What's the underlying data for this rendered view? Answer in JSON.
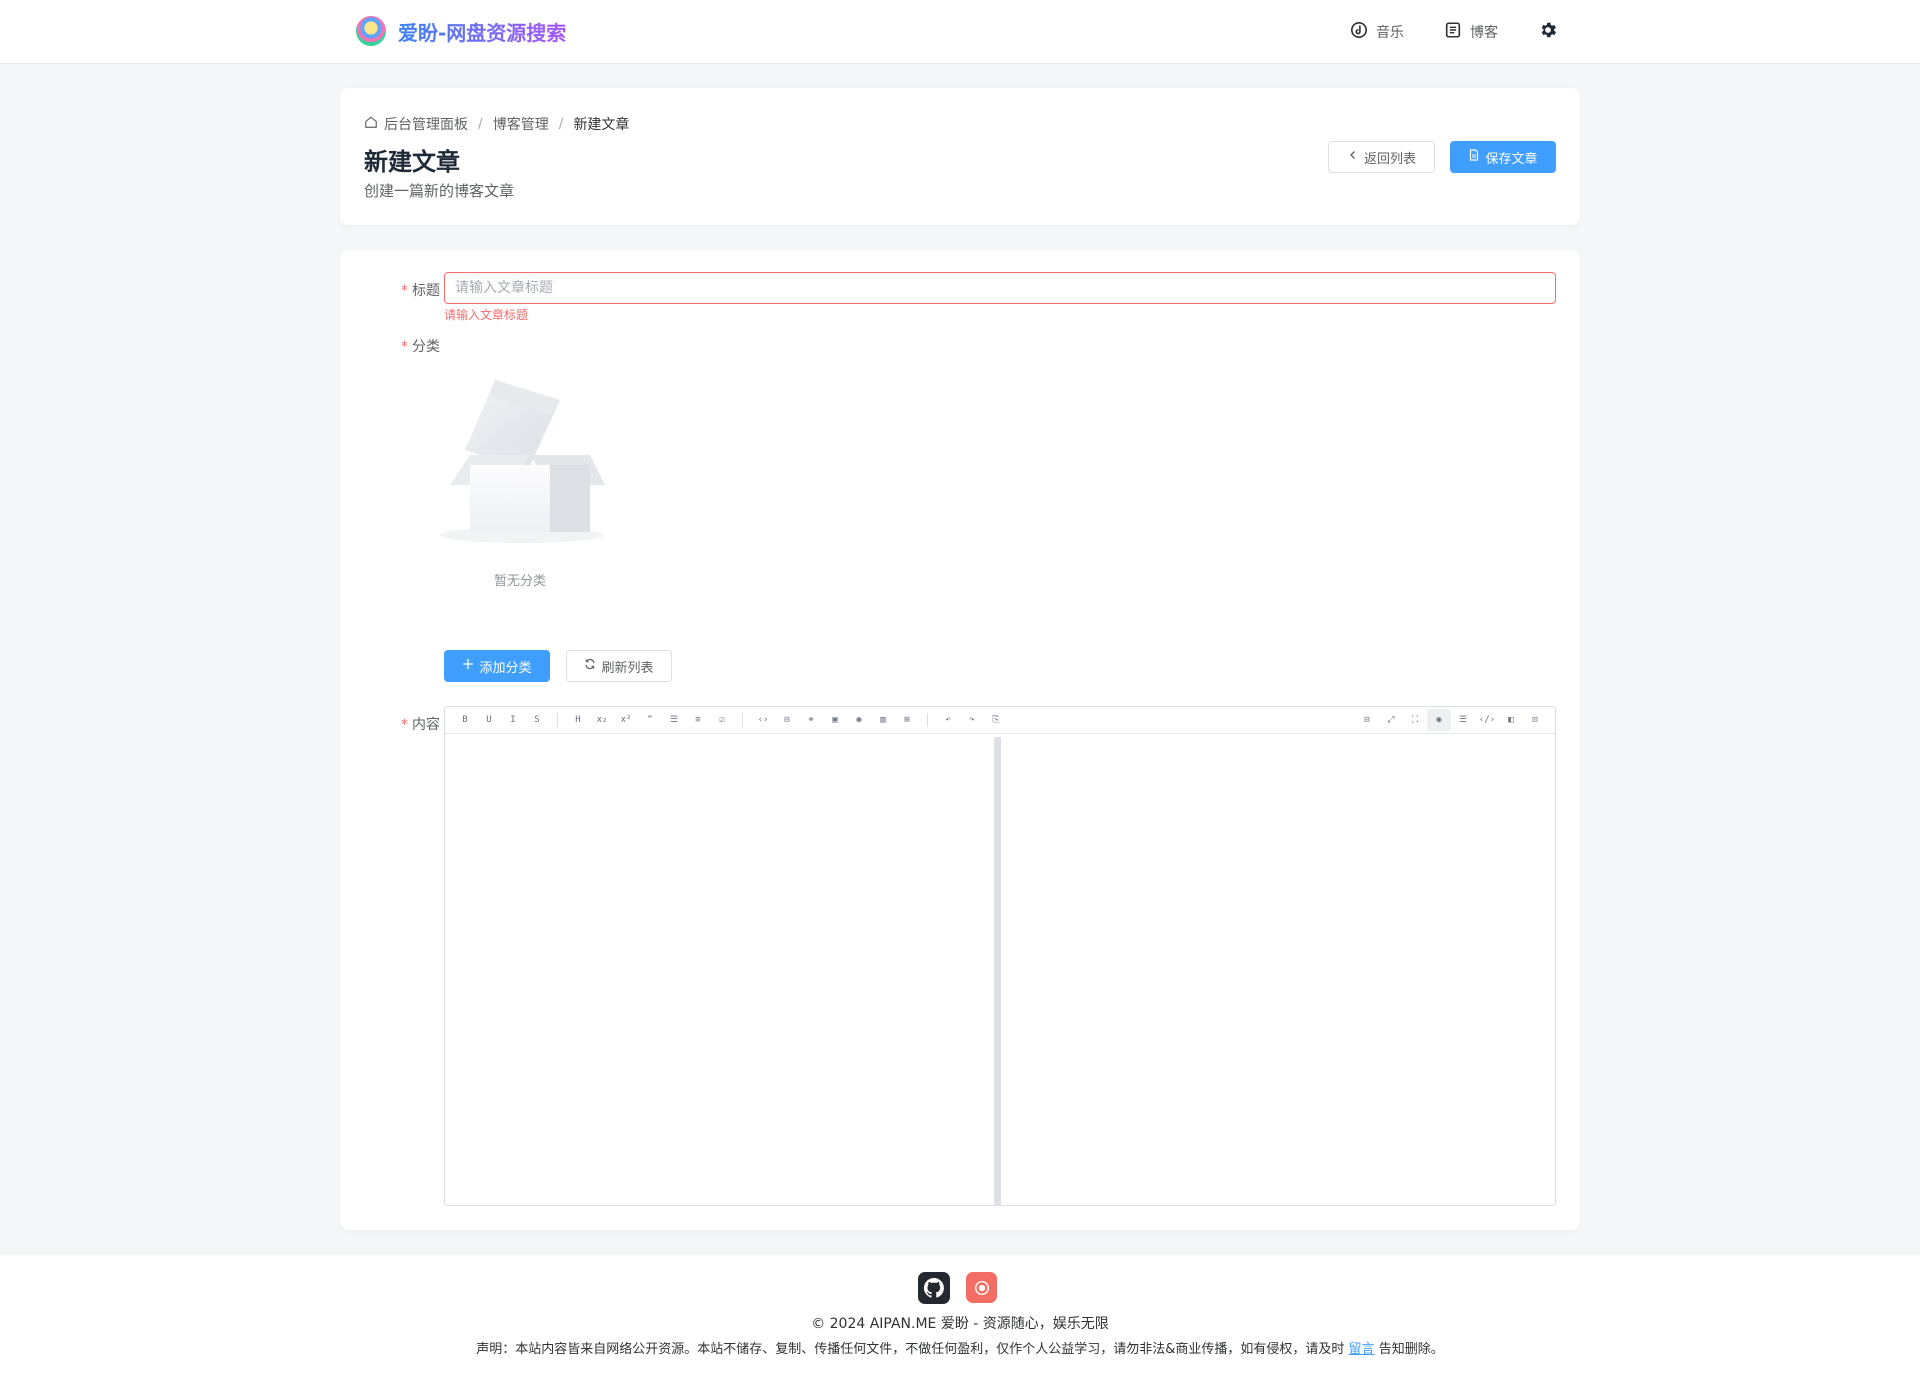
{
  "header": {
    "logo_text": "爱盼-网盘资源搜索",
    "nav": [
      {
        "label": "音乐",
        "icon": "music-disc-icon"
      },
      {
        "label": "博客",
        "icon": "document-icon"
      }
    ],
    "settings_icon": "gear-icon"
  },
  "page_header": {
    "breadcrumb": [
      "后台管理面板",
      "博客管理",
      "新建文章"
    ],
    "title": "新建文章",
    "subtitle": "创建一篇新的博客文章",
    "back_label": "返回列表",
    "save_label": "保存文章"
  },
  "form": {
    "title_label": "标题",
    "title_placeholder": "请输入文章标题",
    "title_error": "请输入文章标题",
    "category_label": "分类",
    "category_empty": "暂无分类",
    "add_category_label": "添加分类",
    "refresh_label": "刷新列表",
    "content_label": "内容",
    "required_mark": "*"
  },
  "editor": {
    "toolbar_left": [
      "B",
      "U",
      "I",
      "S",
      "|",
      "H",
      "x₂",
      "x²",
      "❞",
      "☰",
      "≡",
      "☑",
      "|",
      "‹›",
      "⊟",
      "⚭",
      "▣",
      "◉",
      "▥",
      "⊞",
      "|",
      "↶",
      "↷",
      "⎘"
    ],
    "toolbar_right": [
      "⊟",
      "⤢",
      "⛶",
      "◉",
      "☰",
      "‹/›",
      "◧",
      "⊡"
    ],
    "active_right_index": 3
  },
  "footer": {
    "copyright": "© 2024 AIPAN.ME 爱盼 - 资源随心，娱乐无限",
    "disclaimer_prefix": "声明：本站内容皆来自网络公开资源。本站不储存、复制、传播任何文件，不做任何盈利，仅作个人公益学习，请勿非法&商业传播，如有侵权，请及时",
    "disclaimer_link": "留言",
    "disclaimer_suffix": "告知删除。",
    "social": [
      "github-icon",
      "message-icon"
    ]
  },
  "colors": {
    "primary": "#409eff",
    "danger": "#f56c6c",
    "logo_gradient": [
      "#3b82f6",
      "#a855f7"
    ]
  }
}
